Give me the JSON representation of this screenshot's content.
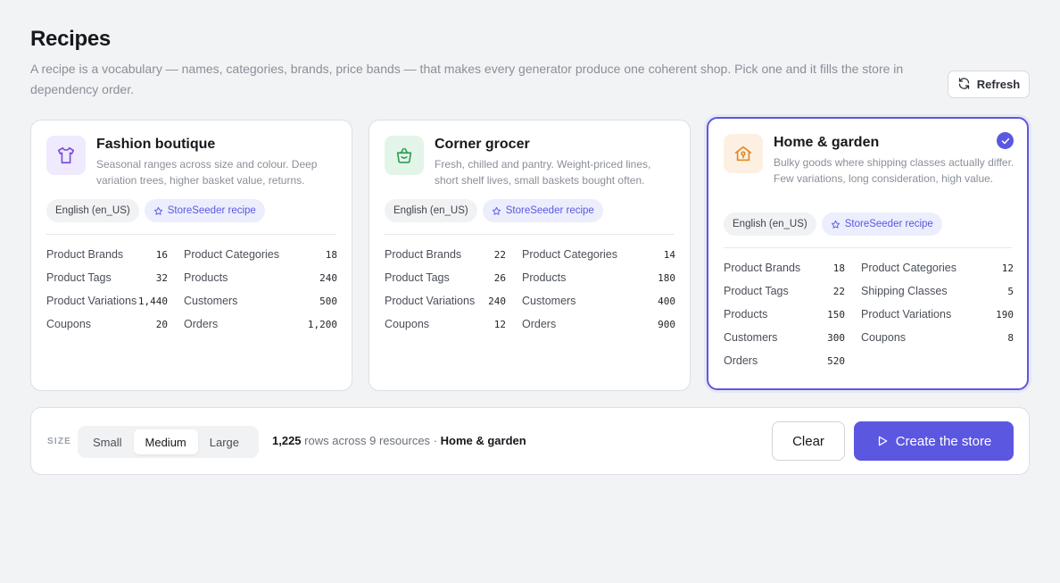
{
  "header": {
    "title": "Recipes",
    "description": "A recipe is a vocabulary — names, categories, brands, price bands — that makes every generator produce one coherent shop. Pick one and it fills the store in dependency order.",
    "refresh_label": "Refresh"
  },
  "cards": [
    {
      "title": "Fashion boutique",
      "description": "Seasonal ranges across size and colour. Deep variation trees, higher basket value, returns.",
      "icon": "shirt-icon",
      "locale": "English (en_US)",
      "badge": "StoreSeeder recipe",
      "selected": false,
      "stats": [
        {
          "label": "Product Brands",
          "value": "16"
        },
        {
          "label": "Product Categories",
          "value": "18"
        },
        {
          "label": "Product Tags",
          "value": "32"
        },
        {
          "label": "Products",
          "value": "240"
        },
        {
          "label": "Product Variations",
          "value": "1,440"
        },
        {
          "label": "Customers",
          "value": "500"
        },
        {
          "label": "Coupons",
          "value": "20"
        },
        {
          "label": "Orders",
          "value": "1,200"
        }
      ]
    },
    {
      "title": "Corner grocer",
      "description": "Fresh, chilled and pantry. Weight-priced lines, short shelf lives, small baskets bought often.",
      "icon": "basket-icon",
      "locale": "English (en_US)",
      "badge": "StoreSeeder recipe",
      "selected": false,
      "stats": [
        {
          "label": "Product Brands",
          "value": "22"
        },
        {
          "label": "Product Categories",
          "value": "14"
        },
        {
          "label": "Product Tags",
          "value": "26"
        },
        {
          "label": "Products",
          "value": "180"
        },
        {
          "label": "Product Variations",
          "value": "240"
        },
        {
          "label": "Customers",
          "value": "400"
        },
        {
          "label": "Coupons",
          "value": "12"
        },
        {
          "label": "Orders",
          "value": "900"
        }
      ]
    },
    {
      "title": "Home & garden",
      "description": "Bulky goods where shipping classes actually differ. Few variations, long consideration, high value.",
      "icon": "house-icon",
      "locale": "English (en_US)",
      "badge": "StoreSeeder recipe",
      "selected": true,
      "stats": [
        {
          "label": "Product Brands",
          "value": "18"
        },
        {
          "label": "Product Categories",
          "value": "12"
        },
        {
          "label": "Product Tags",
          "value": "22"
        },
        {
          "label": "Shipping Classes",
          "value": "5"
        },
        {
          "label": "Products",
          "value": "150"
        },
        {
          "label": "Product Variations",
          "value": "190"
        },
        {
          "label": "Customers",
          "value": "300"
        },
        {
          "label": "Coupons",
          "value": "8"
        },
        {
          "label": "Orders",
          "value": "520"
        }
      ]
    }
  ],
  "footer": {
    "size_label": "SIZE",
    "sizes": [
      "Small",
      "Medium",
      "Large"
    ],
    "selected_size": "Medium",
    "rows_count": "1,225",
    "rows_text": "rows across 9 resources ·",
    "selected_recipe": "Home & garden",
    "clear_label": "Clear",
    "create_label": "Create the store"
  },
  "colors": {
    "accent": "#5b57e0",
    "fashion_bg": "#efeafd",
    "fashion_fg": "#7c4ddb",
    "grocer_bg": "#e3f5e8",
    "grocer_fg": "#2f9e57",
    "home_bg": "#fdf0e2",
    "home_fg": "#e08a2a"
  }
}
